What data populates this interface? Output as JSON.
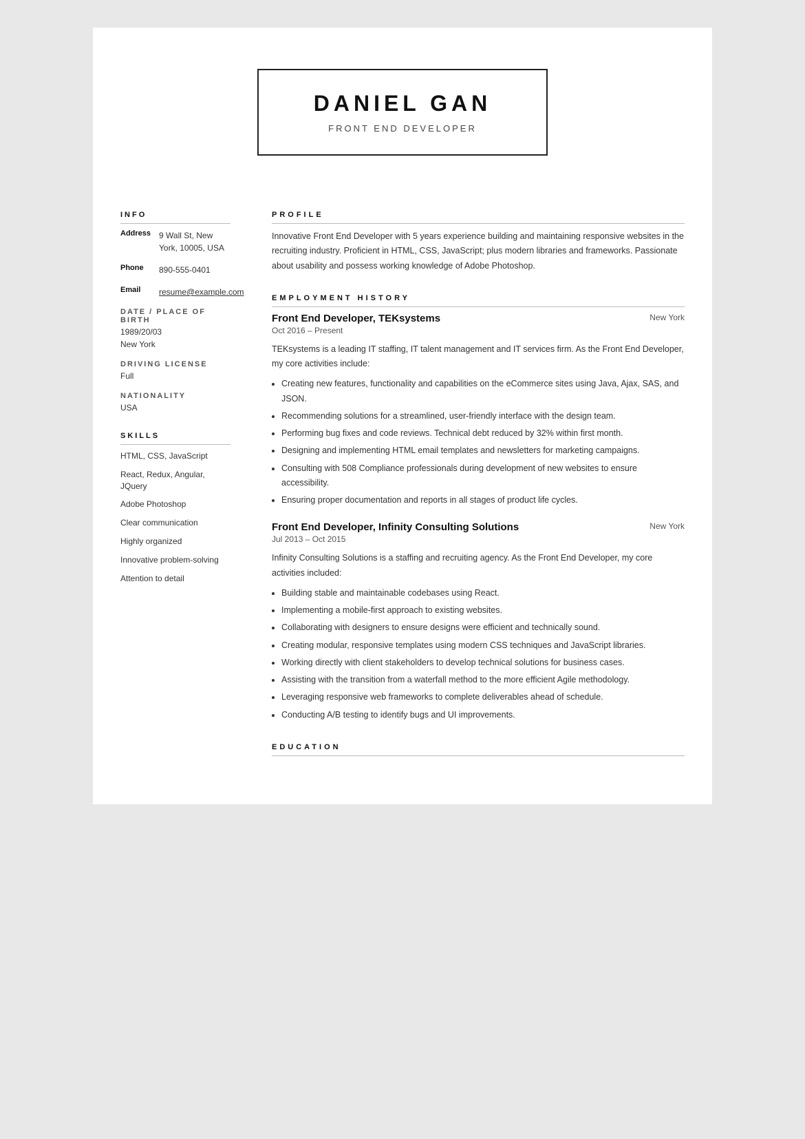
{
  "header": {
    "name": "DANIEL GAN",
    "title": "FRONT END DEVELOPER"
  },
  "sidebar": {
    "info_title": "INFO",
    "address_label": "Address",
    "address_value": "9 Wall St, New York, 10005, USA",
    "phone_label": "Phone",
    "phone_value": "890-555-0401",
    "email_label": "Email",
    "email_value": "resume@example.com",
    "dob_label": "DATE / PLACE OF BIRTH",
    "dob_value": "1989/20/03",
    "dob_place": "New York",
    "license_label": "DRIVING LICENSE",
    "license_value": "Full",
    "nationality_label": "NATIONALITY",
    "nationality_value": "USA",
    "skills_title": "SKILLS",
    "skills": [
      "HTML, CSS, JavaScript",
      "React, Redux, Angular, JQuery",
      "Adobe Photoshop",
      "Clear communication",
      "Highly organized",
      "Innovative problem-solving",
      "Attention to detail"
    ]
  },
  "profile": {
    "title": "PROFILE",
    "text": "Innovative Front End Developer with 5 years experience building and maintaining responsive websites in the recruiting industry. Proficient in HTML, CSS, JavaScript; plus modern libraries and frameworks. Passionate about usability and possess working knowledge of Adobe Photoshop."
  },
  "employment": {
    "title": "EMPLOYMENT HISTORY",
    "jobs": [
      {
        "title": "Front End Developer, TEKsystems",
        "location": "New York",
        "dates": "Oct 2016 – Present",
        "description": "TEKsystems is a leading IT staffing, IT talent management and IT services firm. As the Front End Developer, my core activities include:",
        "bullets": [
          "Creating new features, functionality and capabilities on the eCommerce sites using Java, Ajax, SAS, and JSON.",
          "Recommending solutions for a streamlined, user-friendly interface with the design team.",
          "Performing bug fixes and code reviews. Technical debt reduced by 32% within first month.",
          "Designing and implementing HTML email templates and newsletters for marketing campaigns.",
          "Consulting with 508 Compliance professionals during development of new websites to ensure accessibility.",
          "Ensuring proper documentation and reports in all stages of product life cycles."
        ]
      },
      {
        "title": "Front End Developer, Infinity Consulting Solutions",
        "location": "New York",
        "dates": "Jul 2013 – Oct 2015",
        "description": "Infinity Consulting Solutions is a staffing and recruiting agency. As the Front End Developer, my core activities included:",
        "bullets": [
          "Building stable and maintainable codebases using React.",
          "Implementing a mobile-first approach to existing websites.",
          "Collaborating with designers to ensure designs were efficient and technically sound.",
          "Creating modular, responsive templates using modern CSS techniques and JavaScript libraries.",
          "Working directly with client stakeholders to develop technical solutions for business cases.",
          "Assisting with the transition from a waterfall method to the more efficient Agile methodology.",
          "Leveraging responsive web frameworks to complete deliverables ahead of schedule.",
          "Conducting A/B testing to identify bugs and UI improvements."
        ]
      }
    ]
  },
  "education": {
    "title": "EDUCATION"
  }
}
